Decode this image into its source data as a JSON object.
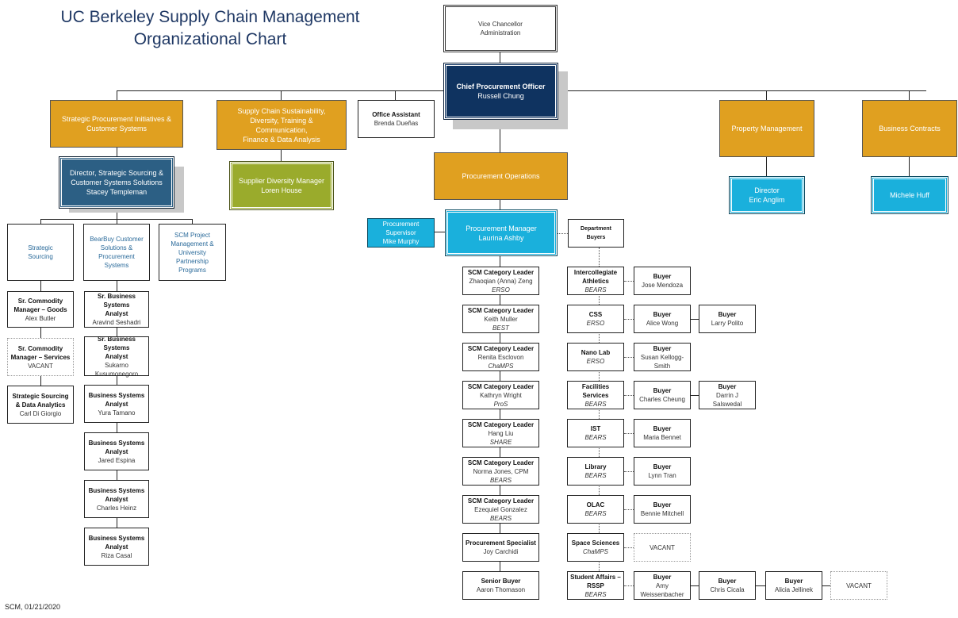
{
  "title": {
    "line1": "UC Berkeley Supply Chain Management",
    "line2": "Organizational Chart"
  },
  "footer": "SCM, 01/21/2020",
  "colors": {
    "gold": "#e0a020",
    "navy": "#0f3360",
    "steel": "#2c5f84",
    "olive": "#9aab2c",
    "cyan": "#1ab0dc",
    "title": "#1f3864"
  },
  "vc": {
    "line1": "Vice Chancellor",
    "line2": "Administration"
  },
  "cpo": {
    "title": "Chief Procurement Officer",
    "name": "Russell Chung"
  },
  "units": {
    "spi": "Strategic Procurement Initiatives & Customer Systems",
    "scs": [
      "Supply Chain Sustainability,",
      "Diversity, Training &",
      "Communication,",
      "Finance & Data Analysis"
    ],
    "po": "Procurement Operations",
    "pm": "Property Management",
    "bc": "Business Contracts"
  },
  "office_assistant": {
    "title": "Office Assistant",
    "name": "Brenda Dueñas"
  },
  "director_ss": {
    "line1": "Director, Strategic Sourcing &",
    "line2": "Customer Systems Solutions",
    "name": "Stacey Templeman"
  },
  "sdm": {
    "title": "Supplier Diversity Manager",
    "name": "Loren House"
  },
  "pm_director": {
    "title": "Director",
    "name": "Eric Anglim"
  },
  "bc_person": {
    "name": "Michele Huff"
  },
  "sub_units": [
    {
      "label": [
        "Strategic",
        "Sourcing"
      ]
    },
    {
      "label": [
        "BearBuy Customer",
        "Solutions &",
        "Procurement",
        "Systems"
      ]
    },
    {
      "label": [
        "SCM Project",
        "Management &",
        "University",
        "Partnership",
        "Programs"
      ]
    }
  ],
  "ss_staff": [
    {
      "title": [
        "Sr. Commodity",
        "Manager – Goods"
      ],
      "name": "Alex Butler"
    },
    {
      "title": [
        "Sr. Commodity",
        "Manager – Services"
      ],
      "name": "VACANT"
    },
    {
      "title": [
        "Strategic Sourcing",
        "& Data Analytics"
      ],
      "name": "Carl Di Giorgio"
    }
  ],
  "bb_staff": [
    {
      "title": [
        "Sr. Business Systems",
        "Analyst"
      ],
      "name": "Aravind Seshadri"
    },
    {
      "title": [
        "Sr. Business Systems",
        "Analyst"
      ],
      "name": "Sukarno Kusumonegoro"
    },
    {
      "title": [
        "Business Systems",
        "Analyst"
      ],
      "name": "Yura Tamano"
    },
    {
      "title": [
        "Business Systems",
        "Analyst"
      ],
      "name": "Jared Espina"
    },
    {
      "title": [
        "Business Systems",
        "Analyst"
      ],
      "name": "Charles Heinz"
    },
    {
      "title": [
        "Business Systems",
        "Analyst"
      ],
      "name": "Riza Casal"
    }
  ],
  "proc_manager": {
    "title": "Procurement Manager",
    "name": "Laurina Ashby"
  },
  "proc_supervisor": {
    "title": [
      "Procurement",
      "Supervisor"
    ],
    "name": "Mike Murphy"
  },
  "dept_buyers_label": "Department Buyers",
  "category_leaders": [
    {
      "title": "SCM Category Leader",
      "name": "Zhaoqian (Anna) Zeng",
      "team": "ERSO"
    },
    {
      "title": "SCM Category Leader",
      "name": "Keith Muller",
      "team": "BEST"
    },
    {
      "title": "SCM Category Leader",
      "name": "Renita Esclovon",
      "team": "ChaMPS"
    },
    {
      "title": "SCM Category Leader",
      "name": "Kathryn Wright",
      "team": "ProS"
    },
    {
      "title": "SCM Category Leader",
      "name": "Hang Liu",
      "team": "SHARE"
    },
    {
      "title": "SCM Category Leader",
      "name": "Norma Jones, CPM",
      "team": "BEARS"
    },
    {
      "title": "SCM Category Leader",
      "name": "Ezequiel Gonzalez",
      "team": "BEARS"
    },
    {
      "title": "Procurement Specialist",
      "name": "Joy Carchidi",
      "team": ""
    },
    {
      "title": "Senior Buyer",
      "name": "Aaron Thomason",
      "team": ""
    }
  ],
  "departments": [
    {
      "name": [
        "Intercollegiate",
        "Athletics"
      ],
      "team": "BEARS",
      "buyers": [
        {
          "title": "Buyer",
          "name": [
            "Jose Mendoza"
          ]
        }
      ]
    },
    {
      "name": [
        "CSS"
      ],
      "team": "ERSO",
      "buyers": [
        {
          "title": "Buyer",
          "name": [
            "Alice Wong"
          ]
        },
        {
          "title": "Buyer",
          "name": [
            "Larry Polito"
          ]
        }
      ]
    },
    {
      "name": [
        "Nano Lab"
      ],
      "team": "ERSO",
      "buyers": [
        {
          "title": "Buyer",
          "name": [
            "Susan Kellogg-",
            "Smith"
          ]
        }
      ]
    },
    {
      "name": [
        "Facilities",
        "Services"
      ],
      "team": "BEARS",
      "buyers": [
        {
          "title": "Buyer",
          "name": [
            "Charles Cheung"
          ]
        },
        {
          "title": "Buyer",
          "name": [
            "Darrin J Salswedal"
          ]
        }
      ]
    },
    {
      "name": [
        "IST"
      ],
      "team": "BEARS",
      "buyers": [
        {
          "title": "Buyer",
          "name": [
            "Maria Bennet"
          ]
        }
      ]
    },
    {
      "name": [
        "Library"
      ],
      "team": "BEARS",
      "buyers": [
        {
          "title": "Buyer",
          "name": [
            "Lynn Tran"
          ]
        }
      ]
    },
    {
      "name": [
        "OLAC"
      ],
      "team": "BEARS",
      "buyers": [
        {
          "title": "Buyer",
          "name": [
            "Bennie Mitchell"
          ]
        }
      ]
    },
    {
      "name": [
        "Space Sciences"
      ],
      "team": "ChaMPS",
      "buyers": [
        {
          "title": "",
          "name": [
            "VACANT"
          ]
        }
      ]
    },
    {
      "name": [
        "Student Affairs –",
        "RSSP"
      ],
      "team": "BEARS",
      "buyers": [
        {
          "title": "Buyer",
          "name": [
            "Amy",
            "Weissenbacher"
          ]
        },
        {
          "title": "Buyer",
          "name": [
            "Chris Cicala"
          ]
        },
        {
          "title": "Buyer",
          "name": [
            "Alicia Jellinek"
          ]
        },
        {
          "title": "",
          "name": [
            "VACANT"
          ]
        }
      ]
    }
  ]
}
